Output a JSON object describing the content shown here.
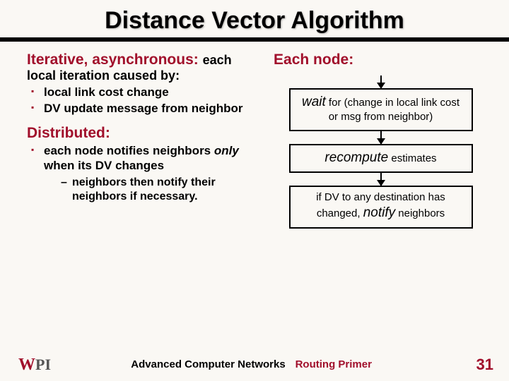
{
  "title": "Distance Vector Algorithm",
  "left": {
    "heading1_term": "Iterative, asynchronous: ",
    "heading1_desc": "each local iteration caused by:",
    "bullets1": {
      "0": "local link cost change",
      "1": "DV update message from neighbor"
    },
    "heading2_term": "Distributed:",
    "bullet2_lead": "each node notifies neighbors ",
    "bullet2_italic": "only",
    "bullet2_tail": " when its DV changes",
    "sub_bullet": "neighbors then notify their neighbors if necessary."
  },
  "right": {
    "heading": "Each node:",
    "box1_kw": "wait",
    "box1_rest": " for (change in local link cost or msg from neighbor)",
    "box2_kw": "recompute",
    "box2_rest": " estimates",
    "box3_lead": "if DV to any destination has changed, ",
    "box3_kw": "notify",
    "box3_tail": " neighbors"
  },
  "footer": {
    "center": "Advanced Computer Networks",
    "right": "Routing Primer",
    "page": "31"
  }
}
